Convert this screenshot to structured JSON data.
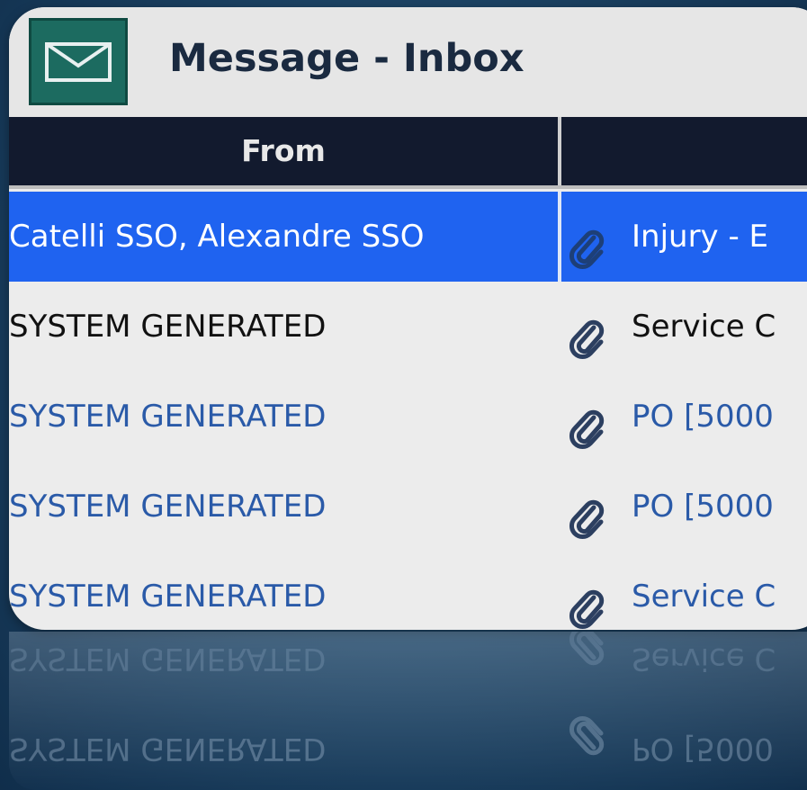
{
  "window": {
    "title": "Message - Inbox",
    "icon": "envelope-icon",
    "accent_color": "#1f63f0",
    "icon_bg_color": "#1c6b60"
  },
  "table": {
    "columns": [
      {
        "label": "From"
      },
      {
        "label": ""
      }
    ],
    "rows": [
      {
        "from": "Catelli SSO, Alexandre SSO",
        "subject": "Injury - E",
        "attachment": true,
        "selected": true,
        "from_color": "#ffffff",
        "subject_color": "#ffffff"
      },
      {
        "from": "SYSTEM GENERATED",
        "subject": "Service C",
        "attachment": true,
        "selected": false,
        "from_color": "#111111",
        "subject_color": "#111111"
      },
      {
        "from": "SYSTEM GENERATED",
        "subject": "PO [5000",
        "attachment": true,
        "selected": false,
        "from_color": "#2a5aa8",
        "subject_color": "#2a5aa8"
      },
      {
        "from": "SYSTEM GENERATED",
        "subject": "PO [5000",
        "attachment": true,
        "selected": false,
        "from_color": "#2a5aa8",
        "subject_color": "#2a5aa8"
      },
      {
        "from": "SYSTEM GENERATED",
        "subject": "Service C",
        "attachment": true,
        "selected": false,
        "from_color": "#2a5aa8",
        "subject_color": "#2a5aa8"
      }
    ]
  }
}
